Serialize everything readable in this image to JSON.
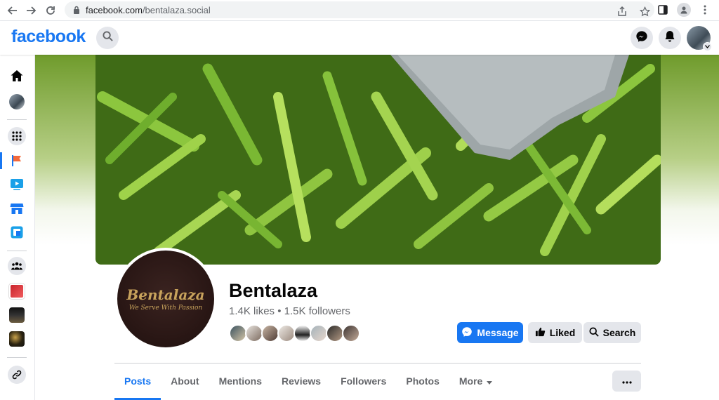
{
  "browser": {
    "url_host": "facebook.com",
    "url_path": "/bentalaza.social"
  },
  "fb": {
    "logo": "facebook"
  },
  "page": {
    "name": "Bentalaza",
    "stats": "1.4K likes • 1.5K followers",
    "profile_brand": "Bentalaza",
    "profile_tagline": "We Serve With Passion"
  },
  "actions": {
    "message": "Message",
    "liked": "Liked",
    "search": "Search"
  },
  "tabs": [
    {
      "label": "Posts",
      "active": true
    },
    {
      "label": "About"
    },
    {
      "label": "Mentions"
    },
    {
      "label": "Reviews"
    },
    {
      "label": "Followers"
    },
    {
      "label": "Photos"
    },
    {
      "label": "More"
    }
  ],
  "colors": {
    "accent": "#1877f2",
    "gray_button": "#e4e6eb",
    "secondary_text": "#65676b"
  },
  "icons": {
    "left_nav": [
      "home-icon",
      "profile-avatar-icon",
      "menu-grid-icon",
      "pages-flag-icon",
      "watch-icon",
      "marketplace-icon",
      "gaming-icon",
      "groups-icon",
      "shortcut-tribe-icon",
      "shortcut-direct-icon",
      "shortcut-dark-icon",
      "see-more-link-icon"
    ]
  }
}
